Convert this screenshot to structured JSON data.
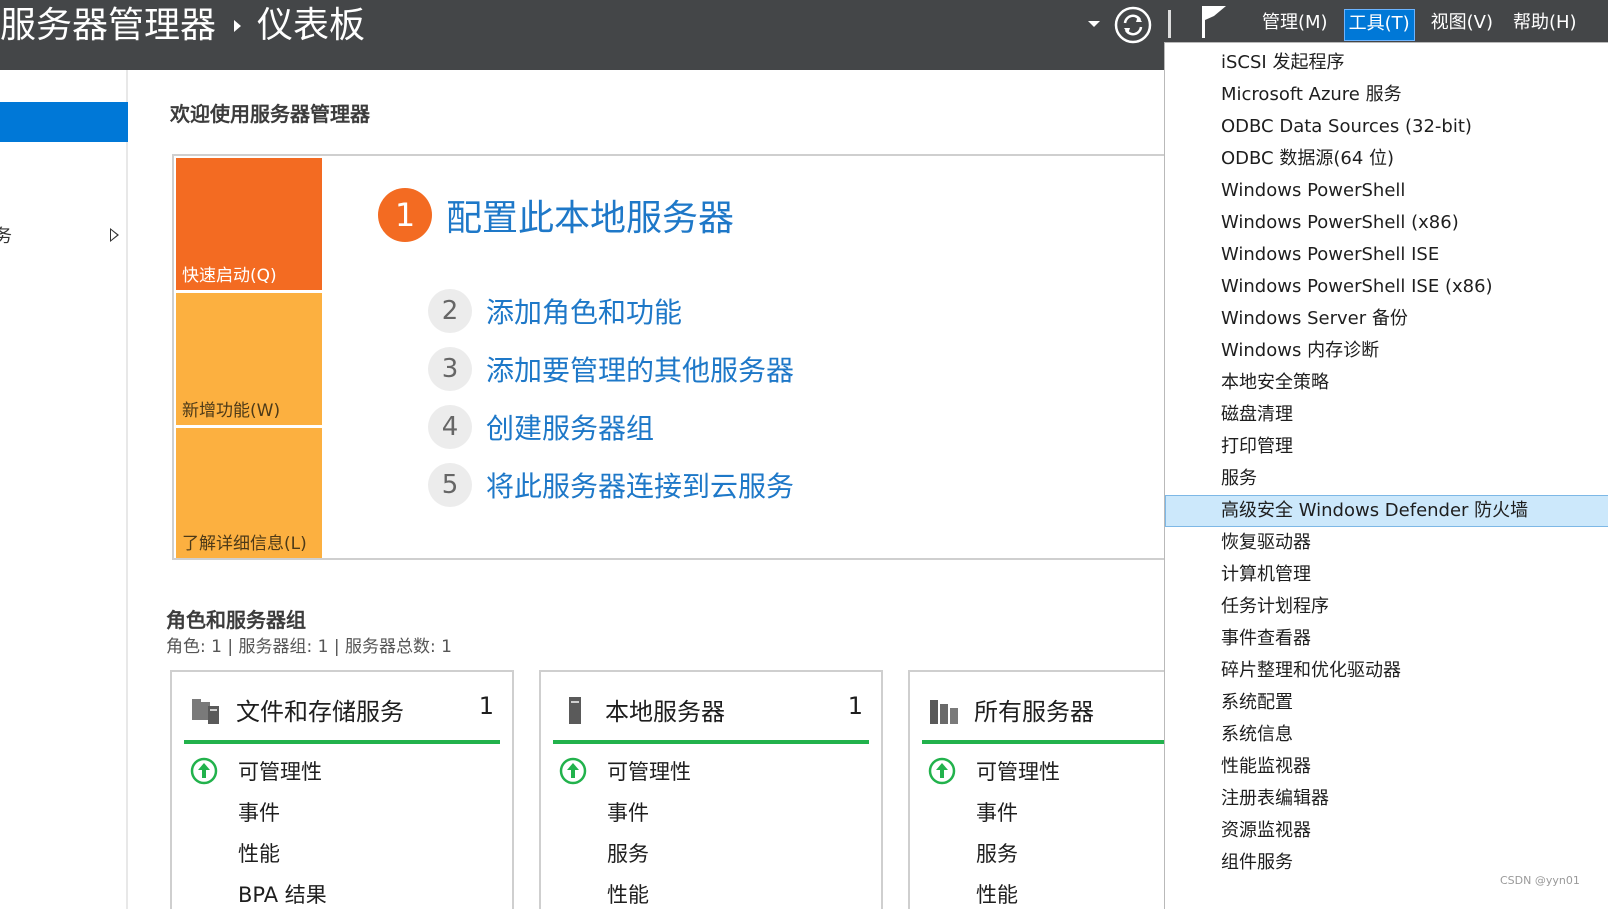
{
  "header": {
    "title_primary": "服务器管理器",
    "title_secondary": "仪表板",
    "menu": [
      {
        "label": "管理(M)",
        "active": false
      },
      {
        "label": "工具(T)",
        "active": true
      },
      {
        "label": "视图(V)",
        "active": false
      },
      {
        "label": "帮助(H)",
        "active": false
      }
    ]
  },
  "leftnav": {
    "partial_label": "务"
  },
  "main": {
    "welcome": "欢迎使用服务器管理器",
    "tiles": [
      "快速启动(Q)",
      "新增功能(W)",
      "了解详细信息(L)"
    ],
    "step1": {
      "num": "1",
      "label": "配置此本地服务器"
    },
    "steps": [
      {
        "num": "2",
        "label": "添加角色和功能"
      },
      {
        "num": "3",
        "label": "添加要管理的其他服务器"
      },
      {
        "num": "4",
        "label": "创建服务器组"
      },
      {
        "num": "5",
        "label": "将此服务器连接到云服务"
      }
    ],
    "roles_title": "角色和服务器组",
    "roles_subtitle": "角色: 1 | 服务器组: 1 | 服务器总数: 1",
    "cards": [
      {
        "title": "文件和存储服务",
        "count": "1",
        "icon": "folder-server-icon",
        "rows": [
          "可管理性",
          "事件",
          "性能",
          "BPA 结果"
        ]
      },
      {
        "title": "本地服务器",
        "count": "1",
        "icon": "server-icon",
        "rows": [
          "可管理性",
          "事件",
          "服务",
          "性能"
        ]
      },
      {
        "title": "所有服务器",
        "count": "",
        "icon": "servers-icon",
        "rows": [
          "可管理性",
          "事件",
          "服务",
          "性能"
        ]
      }
    ]
  },
  "tools_menu": {
    "items": [
      "iSCSI 发起程序",
      "Microsoft Azure 服务",
      "ODBC Data Sources (32-bit)",
      "ODBC 数据源(64 位)",
      "Windows PowerShell",
      "Windows PowerShell (x86)",
      "Windows PowerShell ISE",
      "Windows PowerShell ISE (x86)",
      "Windows Server 备份",
      "Windows 内存诊断",
      "本地安全策略",
      "磁盘清理",
      "打印管理",
      "服务",
      "高级安全 Windows Defender 防火墙",
      "恢复驱动器",
      "计算机管理",
      "任务计划程序",
      "事件查看器",
      "碎片整理和优化驱动器",
      "系统配置",
      "系统信息",
      "性能监视器",
      "注册表编辑器",
      "资源监视器",
      "组件服务"
    ],
    "highlighted_index": 14
  },
  "watermark": "CSDN @yyn01",
  "colors": {
    "header_bg": "#444648",
    "accent_blue": "#0078d7",
    "quickstart_orange": "#f36b22",
    "tile_amber": "#fcb040",
    "link_blue": "#1e78c8",
    "status_green": "#22b24c",
    "menu_highlight": "#cce8fb"
  }
}
